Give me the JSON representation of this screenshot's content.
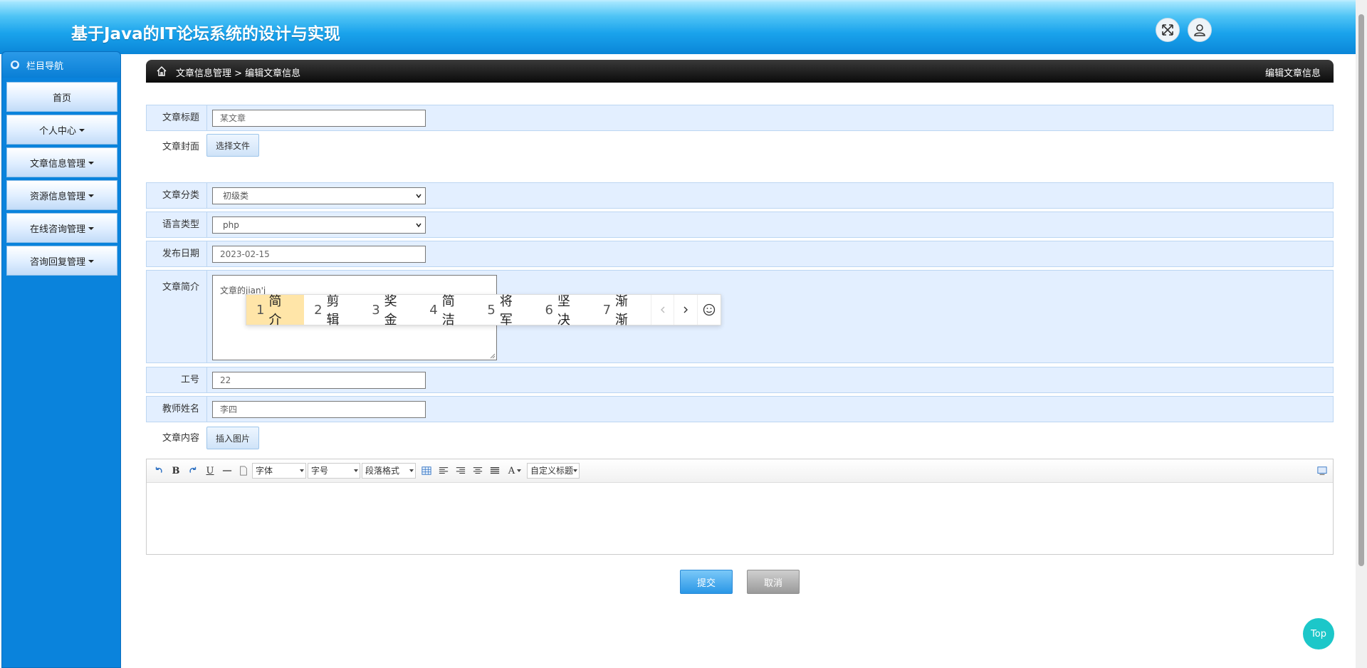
{
  "header": {
    "title": "基于Java的IT论坛系统的设计与实现",
    "fullscreen_icon": "expand-arrows-icon",
    "user_icon": "user-icon"
  },
  "sidebar": {
    "heading": "栏目导航",
    "items": [
      {
        "label": "首页",
        "has_dropdown": false
      },
      {
        "label": "个人中心",
        "has_dropdown": true
      },
      {
        "label": "文章信息管理",
        "has_dropdown": true
      },
      {
        "label": "资源信息管理",
        "has_dropdown": true
      },
      {
        "label": "在线咨询管理",
        "has_dropdown": true
      },
      {
        "label": "咨询回复管理",
        "has_dropdown": true
      }
    ]
  },
  "breadcrumb": {
    "path": "文章信息管理 > 编辑文章信息",
    "page_title": "编辑文章信息"
  },
  "form": {
    "title_label": "文章标题",
    "title_value": "某文章",
    "cover_label": "文章封面",
    "cover_button": "选择文件",
    "category_label": "文章分类",
    "category_value": "初级类",
    "language_label": "语言类型",
    "language_value": "php",
    "date_label": "发布日期",
    "date_value": "2023-02-15",
    "intro_label": "文章简介",
    "intro_value": "文章的jian'j",
    "job_label": "工号",
    "job_value": "22",
    "teacher_label": "教师姓名",
    "teacher_value": "李四",
    "content_label": "文章内容",
    "insert_image_button": "插入图片"
  },
  "ime": {
    "candidates": [
      {
        "num": "1",
        "text": "简介"
      },
      {
        "num": "2",
        "text": "剪辑"
      },
      {
        "num": "3",
        "text": "奖金"
      },
      {
        "num": "4",
        "text": "简洁"
      },
      {
        "num": "5",
        "text": "将军"
      },
      {
        "num": "6",
        "text": "坚决"
      },
      {
        "num": "7",
        "text": "渐渐"
      }
    ]
  },
  "editor": {
    "font_select": "字体",
    "size_select": "字号",
    "paragraph_select": "段落格式",
    "custom_title_select": "自定义标题"
  },
  "buttons": {
    "submit": "提交",
    "cancel": "取消",
    "top": "Top"
  },
  "colors": {
    "header_blue": "#1aa3ec",
    "sidebar_blue": "#0a83dc",
    "row_shade": "#e3efff",
    "submit_blue": "#2a97e6",
    "top_teal": "#1cc7c9",
    "ime_highlight": "#ffe5a8"
  }
}
